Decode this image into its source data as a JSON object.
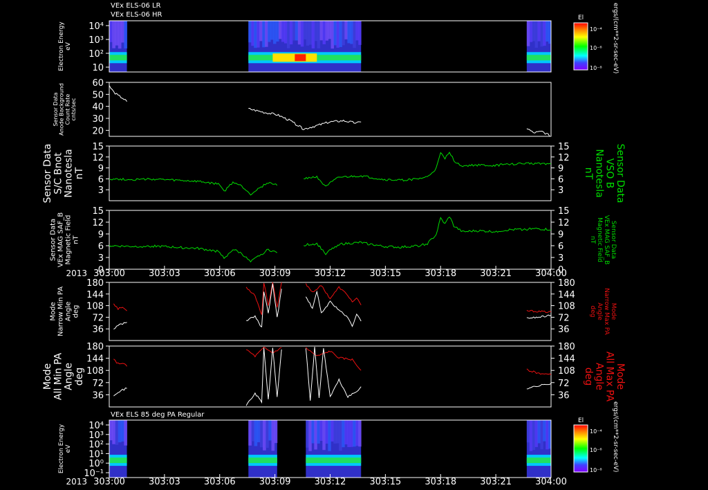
{
  "titles": {
    "top_line1": "VEx ELS-06 LR",
    "top_line2": "VEx ELS-06 HR",
    "bottom": "VEx ELS 85 deg PA Regular"
  },
  "year_label": "2013",
  "time_ticks": [
    "303:00",
    "303:03",
    "303:06",
    "303:09",
    "303:12",
    "303:15",
    "303:18",
    "303:21",
    "304:00"
  ],
  "colorbar": {
    "title": "El",
    "unit_label": "ergs/(cm**2-sr-sec-eV)",
    "ticks_top": [
      "10⁻⁴",
      "10⁻⁶",
      "10⁻⁸"
    ],
    "ticks_bottom": [
      "10⁻⁴",
      "10⁻⁶",
      "10⁻⁸"
    ]
  },
  "colors": {
    "green": "#00dd00",
    "red": "#ee1111",
    "white": "#ffffff",
    "frame": "#ffffff"
  },
  "chart_data": [
    {
      "type": "heatmap",
      "ylabel": [
        "Electron Energy",
        "eV"
      ],
      "y_ticks": [
        "10⁴",
        "10³",
        "10²",
        "10"
      ],
      "log_scale": true,
      "data_intervals": [
        [
          0,
          0.04
        ],
        [
          0.315,
          0.57
        ],
        [
          0.945,
          1.0
        ]
      ],
      "band": "~5-20 eV intense band, peak near 303:08"
    },
    {
      "type": "line",
      "ylabel": [
        "Sensor Data",
        "Anode Background",
        "Count Rate",
        "cnts/sec"
      ],
      "ylim": [
        15,
        60
      ],
      "y_ticks": [
        "60",
        "50",
        "40",
        "30",
        "20"
      ],
      "series": [
        {
          "color": "white",
          "segments": [
            [
              [
                0,
                57
              ],
              [
                0.01,
                52
              ],
              [
                0.02,
                49
              ],
              [
                0.03,
                47
              ],
              [
                0.04,
                44
              ]
            ],
            [
              [
                0.315,
                38
              ],
              [
                0.35,
                35
              ],
              [
                0.38,
                33
              ],
              [
                0.41,
                28
              ],
              [
                0.44,
                21
              ],
              [
                0.47,
                24
              ],
              [
                0.5,
                27
              ],
              [
                0.53,
                28
              ],
              [
                0.56,
                26
              ],
              [
                0.57,
                27
              ]
            ],
            [
              [
                0.945,
                22
              ],
              [
                0.96,
                18
              ],
              [
                0.98,
                19
              ],
              [
                1.0,
                15
              ]
            ]
          ]
        }
      ]
    },
    {
      "type": "line",
      "ylabel": [
        "Sensor Data",
        "S/C Bnot",
        "Nanotesla",
        "nT"
      ],
      "ylabel_right": [
        "Sensor Data",
        "VSO B",
        "Nanotesla",
        "nT"
      ],
      "ylim": [
        0,
        15
      ],
      "y_ticks": [
        "15",
        "12",
        "9",
        "6",
        "3"
      ],
      "series": [
        {
          "color": "green",
          "segments": [
            [
              [
                0,
                6
              ],
              [
                0.05,
                5.8
              ],
              [
                0.1,
                5.9
              ],
              [
                0.15,
                5.6
              ],
              [
                0.2,
                5.3
              ],
              [
                0.25,
                4.5
              ],
              [
                0.26,
                2.5
              ],
              [
                0.28,
                5.1
              ],
              [
                0.3,
                4
              ],
              [
                0.32,
                1.8
              ],
              [
                0.34,
                3.5
              ],
              [
                0.36,
                5
              ],
              [
                0.38,
                4.2
              ]
            ],
            [
              [
                0.44,
                6.2
              ],
              [
                0.47,
                6.5
              ],
              [
                0.49,
                4
              ],
              [
                0.52,
                6.4
              ],
              [
                0.57,
                6.8
              ],
              [
                0.62,
                5.8
              ],
              [
                0.66,
                5.6
              ],
              [
                0.7,
                6
              ],
              [
                0.72,
                6.5
              ],
              [
                0.74,
                8.8
              ],
              [
                0.75,
                13
              ],
              [
                0.76,
                11.5
              ],
              [
                0.77,
                13.5
              ],
              [
                0.78,
                11
              ],
              [
                0.8,
                9.5
              ],
              [
                0.83,
                9.8
              ],
              [
                0.87,
                9.6
              ],
              [
                0.9,
                10
              ],
              [
                0.94,
                10.2
              ],
              [
                0.97,
                10.3
              ],
              [
                1.0,
                10.1
              ]
            ]
          ]
        }
      ]
    },
    {
      "type": "line",
      "ylabel": [
        "Sensor Data",
        "VEx MAG SAF_B",
        "Magnetic Field",
        "nT"
      ],
      "ylabel_right": [
        "Sensor Data",
        "VEx MAG SAF_B",
        "Magnetic Field",
        "nT"
      ],
      "ylim": [
        0,
        15
      ],
      "y_ticks": [
        "15",
        "12",
        "9",
        "6",
        "3",
        "0"
      ],
      "series": [
        {
          "color": "green",
          "segments": [
            [
              [
                0,
                6
              ],
              [
                0.05,
                5.8
              ],
              [
                0.1,
                5.9
              ],
              [
                0.15,
                5.6
              ],
              [
                0.2,
                5.3
              ],
              [
                0.25,
                4.5
              ],
              [
                0.26,
                2.5
              ],
              [
                0.28,
                5.1
              ],
              [
                0.3,
                4
              ],
              [
                0.32,
                1.8
              ],
              [
                0.34,
                3.5
              ],
              [
                0.36,
                5
              ],
              [
                0.38,
                4.2
              ]
            ],
            [
              [
                0.44,
                6.2
              ],
              [
                0.47,
                6.5
              ],
              [
                0.49,
                4
              ],
              [
                0.52,
                6.4
              ],
              [
                0.57,
                6.8
              ],
              [
                0.62,
                5.8
              ],
              [
                0.66,
                5.6
              ],
              [
                0.7,
                6
              ],
              [
                0.72,
                6.5
              ],
              [
                0.74,
                8.8
              ],
              [
                0.75,
                13
              ],
              [
                0.76,
                11.5
              ],
              [
                0.77,
                13.5
              ],
              [
                0.78,
                11
              ],
              [
                0.8,
                9.5
              ],
              [
                0.83,
                9.8
              ],
              [
                0.87,
                9.6
              ],
              [
                0.9,
                10
              ],
              [
                0.94,
                10.2
              ],
              [
                0.97,
                10.3
              ],
              [
                1.0,
                10.1
              ]
            ]
          ]
        }
      ]
    },
    {
      "type": "line",
      "ylabel": [
        "Mode",
        "Narrow Min PA",
        "Angle",
        "deg"
      ],
      "ylabel_right": [
        "Mode",
        "Narrow Max PA",
        "Angle",
        "deg"
      ],
      "ylim": [
        0,
        180
      ],
      "y_ticks": [
        "180",
        "144",
        "108",
        "72",
        "36"
      ],
      "series": [
        {
          "color": "red",
          "segments": [
            [
              [
                0.01,
                115
              ],
              [
                0.02,
                98
              ],
              [
                0.03,
                103
              ],
              [
                0.04,
                92
              ]
            ],
            [
              [
                0.31,
                165
              ],
              [
                0.33,
                140
              ],
              [
                0.345,
                80
              ],
              [
                0.35,
                180
              ],
              [
                0.36,
                110
              ],
              [
                0.37,
                180
              ],
              [
                0.38,
                100
              ],
              [
                0.39,
                180
              ]
            ],
            [
              [
                0.445,
                175
              ],
              [
                0.46,
                150
              ],
              [
                0.48,
                170
              ],
              [
                0.5,
                130
              ],
              [
                0.52,
                165
              ],
              [
                0.54,
                140
              ],
              [
                0.55,
                120
              ],
              [
                0.56,
                130
              ],
              [
                0.57,
                110
              ]
            ],
            [
              [
                0.945,
                92
              ],
              [
                0.97,
                90
              ],
              [
                1.0,
                88
              ]
            ]
          ]
        },
        {
          "color": "white",
          "segments": [
            [
              [
                0.01,
                35
              ],
              [
                0.02,
                48
              ],
              [
                0.03,
                52
              ],
              [
                0.04,
                56
              ]
            ],
            [
              [
                0.31,
                62
              ],
              [
                0.33,
                75
              ],
              [
                0.345,
                40
              ],
              [
                0.35,
                150
              ],
              [
                0.36,
                85
              ],
              [
                0.37,
                175
              ],
              [
                0.38,
                70
              ],
              [
                0.39,
                160
              ]
            ],
            [
              [
                0.445,
                135
              ],
              [
                0.46,
                100
              ],
              [
                0.47,
                150
              ],
              [
                0.48,
                85
              ],
              [
                0.5,
                120
              ],
              [
                0.52,
                95
              ],
              [
                0.54,
                70
              ],
              [
                0.55,
                45
              ],
              [
                0.56,
                80
              ],
              [
                0.57,
                60
              ]
            ],
            [
              [
                0.945,
                70
              ],
              [
                0.97,
                72
              ],
              [
                1.0,
                78
              ]
            ]
          ]
        }
      ]
    },
    {
      "type": "line",
      "ylabel": [
        "Mode",
        "All Min PA",
        "Angle",
        "deg"
      ],
      "ylabel_right": [
        "Mode",
        "All Max PA",
        "Angle",
        "deg"
      ],
      "ylim": [
        0,
        180
      ],
      "y_ticks": [
        "180",
        "144",
        "108",
        "72",
        "36"
      ],
      "series": [
        {
          "color": "red",
          "segments": [
            [
              [
                0.01,
                140
              ],
              [
                0.02,
                128
              ],
              [
                0.03,
                130
              ],
              [
                0.04,
                120
              ]
            ],
            [
              [
                0.31,
                170
              ],
              [
                0.33,
                150
              ],
              [
                0.35,
                175
              ],
              [
                0.37,
                160
              ],
              [
                0.39,
                175
              ]
            ],
            [
              [
                0.445,
                175
              ],
              [
                0.47,
                150
              ],
              [
                0.5,
                165
              ],
              [
                0.52,
                145
              ],
              [
                0.55,
                140
              ],
              [
                0.57,
                108
              ]
            ],
            [
              [
                0.945,
                110
              ],
              [
                0.97,
                100
              ],
              [
                1.0,
                95
              ]
            ]
          ]
        },
        {
          "color": "white",
          "segments": [
            [
              [
                0.01,
                35
              ],
              [
                0.02,
                45
              ],
              [
                0.03,
                50
              ],
              [
                0.04,
                55
              ]
            ],
            [
              [
                0.31,
                5
              ],
              [
                0.33,
                40
              ],
              [
                0.345,
                15
              ],
              [
                0.35,
                175
              ],
              [
                0.36,
                20
              ],
              [
                0.37,
                175
              ],
              [
                0.38,
                30
              ],
              [
                0.39,
                170
              ]
            ],
            [
              [
                0.445,
                175
              ],
              [
                0.455,
                20
              ],
              [
                0.465,
                175
              ],
              [
                0.475,
                25
              ],
              [
                0.485,
                175
              ],
              [
                0.5,
                30
              ],
              [
                0.52,
                80
              ],
              [
                0.54,
                30
              ],
              [
                0.56,
                45
              ],
              [
                0.57,
                60
              ]
            ],
            [
              [
                0.945,
                55
              ],
              [
                0.97,
                62
              ],
              [
                1.0,
                70
              ]
            ]
          ]
        }
      ]
    },
    {
      "type": "heatmap",
      "ylabel": [
        "Electron Energy",
        "eV"
      ],
      "y_ticks": [
        "10⁴",
        "10³",
        "10²",
        "10¹",
        "10⁰",
        "10⁻¹"
      ],
      "log_scale": true,
      "data_intervals": [
        [
          0,
          0.04
        ],
        [
          0.315,
          0.38
        ],
        [
          0.445,
          0.57
        ],
        [
          0.945,
          1.0
        ]
      ],
      "band": "~3-20 eV band"
    }
  ]
}
